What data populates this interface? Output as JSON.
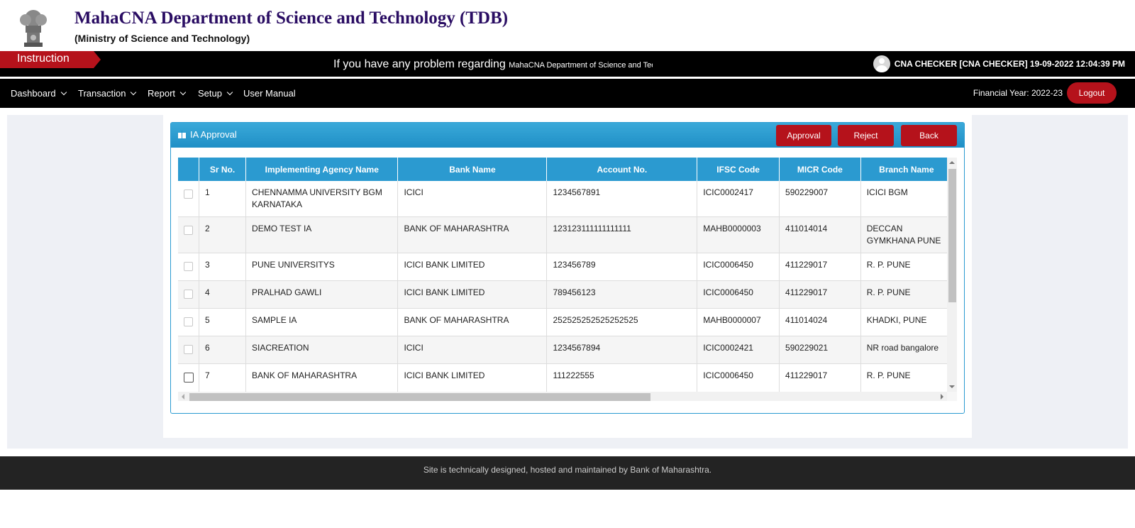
{
  "header": {
    "title": "MahaCNA Department of Science and Technology (TDB)",
    "subtitle": "(Ministry of Science and Technology)"
  },
  "instruction": {
    "tag": "Instruction",
    "marquee_big": "If you have any problem regarding",
    "marquee_small": "MahaCNA Department of Science and Technology (TDB)"
  },
  "user": {
    "info": "CNA CHECKER [CNA CHECKER] 19-09-2022 12:04:39 PM"
  },
  "nav": {
    "items": [
      "Dashboard",
      "Transaction",
      "Report",
      "Setup",
      "User Manual"
    ],
    "financial_year": "Financial Year: 2022-23",
    "logout": "Logout"
  },
  "panel": {
    "title": "IA Approval",
    "buttons": {
      "approval": "Approval",
      "reject": "Reject",
      "back": "Back"
    }
  },
  "table": {
    "columns": [
      "",
      "Sr No.",
      "Implementing Agency Name",
      "Bank Name",
      "Account No.",
      "IFSC Code",
      "MICR Code",
      "Branch Name"
    ],
    "rows": [
      {
        "sr": "1",
        "agency": "CHENNAMMA UNIVERSITY BGM KARNATAKA",
        "bank": "ICICI",
        "account": "1234567891",
        "ifsc": "ICIC0002417",
        "micr": "590229007",
        "branch": "ICICI BGM"
      },
      {
        "sr": "2",
        "agency": "DEMO TEST IA",
        "bank": "BANK OF MAHARASHTRA",
        "account": "123123111111111111",
        "ifsc": "MAHB0000003",
        "micr": "411014014",
        "branch": "DECCAN GYMKHANA PUNE"
      },
      {
        "sr": "3",
        "agency": "PUNE UNIVERSITYS",
        "bank": "ICICI BANK LIMITED",
        "account": "123456789",
        "ifsc": "ICIC0006450",
        "micr": "411229017",
        "branch": "R. P. PUNE"
      },
      {
        "sr": "4",
        "agency": "PRALHAD GAWLI",
        "bank": "ICICI BANK LIMITED",
        "account": "789456123",
        "ifsc": "ICIC0006450",
        "micr": "411229017",
        "branch": "R. P. PUNE"
      },
      {
        "sr": "5",
        "agency": "SAMPLE IA",
        "bank": "BANK OF MAHARASHTRA",
        "account": "252525252525252525",
        "ifsc": "MAHB0000007",
        "micr": "411014024",
        "branch": "KHADKI, PUNE"
      },
      {
        "sr": "6",
        "agency": "SIACREATION",
        "bank": "ICICI",
        "account": "1234567894",
        "ifsc": "ICIC0002421",
        "micr": "590229021",
        "branch": "NR road bangalore"
      },
      {
        "sr": "7",
        "agency": "BANK OF MAHARASHTRA",
        "bank": "ICICI BANK LIMITED",
        "account": "111222555",
        "ifsc": "ICIC0006450",
        "micr": "411229017",
        "branch": "R. P. PUNE"
      }
    ]
  },
  "footer": {
    "text": "Site is technically designed, hosted and maintained by Bank of Maharashtra."
  },
  "colors": {
    "brand_red": "#b5121b",
    "header_blue": "#2b9ad0",
    "title_purple": "#2a0d63"
  }
}
